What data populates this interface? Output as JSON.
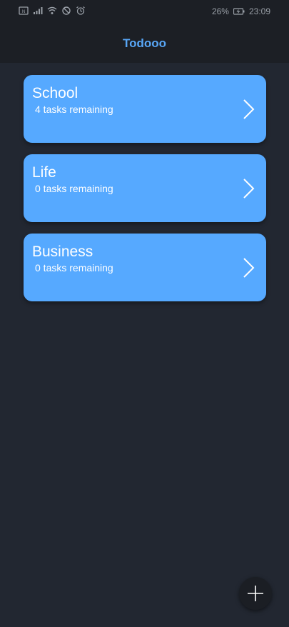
{
  "status_bar": {
    "left_icons": [
      "nfc-icon",
      "signal-icon",
      "wifi-icon",
      "do-not-disturb-icon",
      "alarm-icon"
    ],
    "battery_percent": "26%",
    "time": "23:09"
  },
  "header": {
    "title": "Todooo",
    "title_color": "#58a6f6"
  },
  "lists": [
    {
      "name": "School",
      "subtitle": "4 tasks remaining"
    },
    {
      "name": "Life",
      "subtitle": "0 tasks remaining"
    },
    {
      "name": "Business",
      "subtitle": "0 tasks remaining"
    }
  ],
  "colors": {
    "background": "#222731",
    "card": "#56a9ff",
    "header": "#1c1f25"
  },
  "fab": {
    "icon": "plus-icon"
  }
}
